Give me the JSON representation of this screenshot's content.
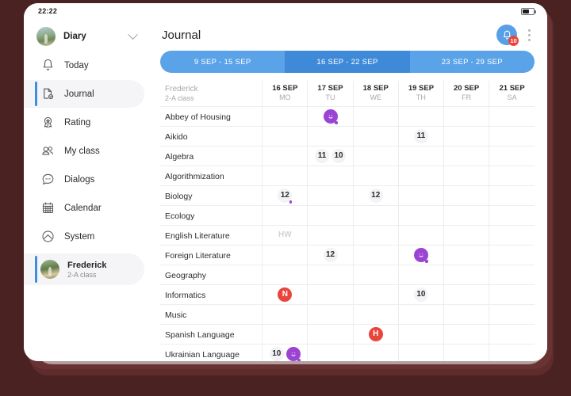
{
  "status_bar": {
    "time": "22:22",
    "battery_icon": "battery-icon"
  },
  "sidebar": {
    "account": {
      "name": "Diary",
      "avatar_icon": "avatar",
      "chevron_icon": "chevron-down-icon"
    },
    "items": [
      {
        "label": "Today",
        "icon": "bell-icon",
        "active": false
      },
      {
        "label": "Journal",
        "icon": "journal-icon",
        "active": true
      },
      {
        "label": "Rating",
        "icon": "award-icon",
        "active": false
      },
      {
        "label": "My class",
        "icon": "people-icon",
        "active": false
      },
      {
        "label": "Dialogs",
        "icon": "chat-icon",
        "active": false
      },
      {
        "label": "Calendar",
        "icon": "calendar-icon",
        "active": false
      },
      {
        "label": "System",
        "icon": "system-icon",
        "active": false
      }
    ],
    "profile": {
      "name": "Frederick",
      "sub": "2-A class",
      "avatar_icon": "avatar"
    }
  },
  "header": {
    "title": "Journal",
    "bell_icon": "bell-icon",
    "notification_count": "10",
    "menu_icon": "kebab-menu-icon"
  },
  "weeks": [
    {
      "label": "9 SEP - 15 SEP",
      "active": false
    },
    {
      "label": "16 SEP - 22 SEP",
      "active": true
    },
    {
      "label": "23 SEP - 29 SEP",
      "active": false
    }
  ],
  "table": {
    "student": {
      "name": "Frederick",
      "class": "2-A class"
    },
    "days": [
      {
        "date": "16 SEP",
        "dow": "MO"
      },
      {
        "date": "17 SEP",
        "dow": "TU"
      },
      {
        "date": "18 SEP",
        "dow": "WE"
      },
      {
        "date": "19 SEP",
        "dow": "TH"
      },
      {
        "date": "20 SEP",
        "dow": "FR"
      },
      {
        "date": "21 SEP",
        "dow": "SA"
      }
    ],
    "rows": [
      {
        "subject": "Abbey of Housing",
        "cells": [
          [],
          [
            {
              "type": "smiley",
              "dot": true
            }
          ],
          [],
          [],
          [],
          []
        ]
      },
      {
        "subject": "Aikido",
        "cells": [
          [],
          [],
          [],
          [
            {
              "type": "grade",
              "value": "11"
            }
          ],
          [],
          []
        ]
      },
      {
        "subject": "Algebra",
        "cells": [
          [],
          [
            {
              "type": "grade",
              "value": "11"
            },
            {
              "type": "grade",
              "value": "10"
            }
          ],
          [],
          [],
          [],
          []
        ]
      },
      {
        "subject": "Algorithmization",
        "cells": [
          [],
          [],
          [],
          [],
          [],
          []
        ]
      },
      {
        "subject": "Biology",
        "cells": [
          [
            {
              "type": "grade",
              "value": "12",
              "dot": true
            }
          ],
          [],
          [
            {
              "type": "grade",
              "value": "12"
            }
          ],
          [],
          [],
          []
        ]
      },
      {
        "subject": "Ecology",
        "cells": [
          [],
          [],
          [],
          [],
          [],
          []
        ]
      },
      {
        "subject": "English Literature",
        "cells": [
          [
            {
              "type": "hw",
              "value": "HW"
            }
          ],
          [],
          [],
          [],
          [],
          []
        ]
      },
      {
        "subject": "Foreign Literature",
        "cells": [
          [],
          [
            {
              "type": "grade",
              "value": "12"
            }
          ],
          [],
          [
            {
              "type": "smiley",
              "dot": true
            }
          ],
          [],
          []
        ]
      },
      {
        "subject": "Geography",
        "cells": [
          [],
          [],
          [],
          [],
          [],
          []
        ]
      },
      {
        "subject": "Informatics",
        "cells": [
          [
            {
              "type": "absent",
              "value": "N"
            }
          ],
          [],
          [],
          [
            {
              "type": "grade",
              "value": "10"
            }
          ],
          [],
          []
        ]
      },
      {
        "subject": "Music",
        "cells": [
          [],
          [],
          [],
          [],
          [],
          []
        ]
      },
      {
        "subject": "Spanish Language",
        "cells": [
          [],
          [],
          [
            {
              "type": "absent",
              "value": "H"
            }
          ],
          [],
          [],
          []
        ]
      },
      {
        "subject": "Ukrainian Language",
        "cells": [
          [
            {
              "type": "grade",
              "value": "10"
            },
            {
              "type": "smiley",
              "dot": true
            }
          ],
          [],
          [],
          [],
          [],
          []
        ]
      }
    ]
  },
  "colors": {
    "accent_blue": "#3d8ee0",
    "tab_active": "#3f8ad8",
    "tab_inactive": "#5aa3e8",
    "absent_red": "#e8453c",
    "smiley_purple": "#9b44d4",
    "backdrop": "#4a2222"
  }
}
